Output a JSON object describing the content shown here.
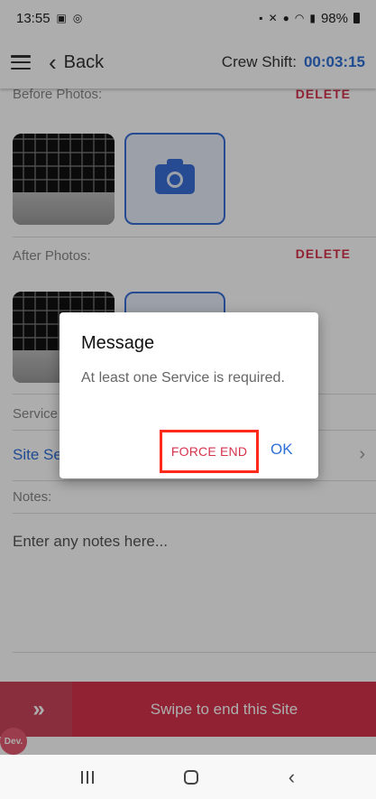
{
  "status_bar": {
    "time": "13:55",
    "battery": "98%",
    "left_icons": [
      "calendar-icon",
      "sync-icon"
    ],
    "right_icons": [
      "lock-icon",
      "mute-icon",
      "location-icon",
      "wifi-icon",
      "signal-icon"
    ]
  },
  "header": {
    "back_label": "Back",
    "crew_label": "Crew Shift:",
    "crew_timer": "00:03:15"
  },
  "before": {
    "label": "Before Photos:",
    "delete_label": "DELETE"
  },
  "after": {
    "label": "After Photos:",
    "delete_label": "DELETE"
  },
  "services": {
    "label": "Service",
    "site_services_label": "Site Se"
  },
  "notes": {
    "label": "Notes:",
    "placeholder": "Enter any notes here..."
  },
  "swipe": {
    "label": "Swipe to end this Site",
    "handle_glyph": "»"
  },
  "dev_badge": "Dev.",
  "dialog": {
    "title": "Message",
    "body": "At least one Service is required.",
    "force_end_label": "FORCE END",
    "ok_label": "OK"
  },
  "colors": {
    "accent_blue": "#2f6fd6",
    "accent_red": "#d6334d",
    "highlight_box": "#ff2a1a"
  }
}
